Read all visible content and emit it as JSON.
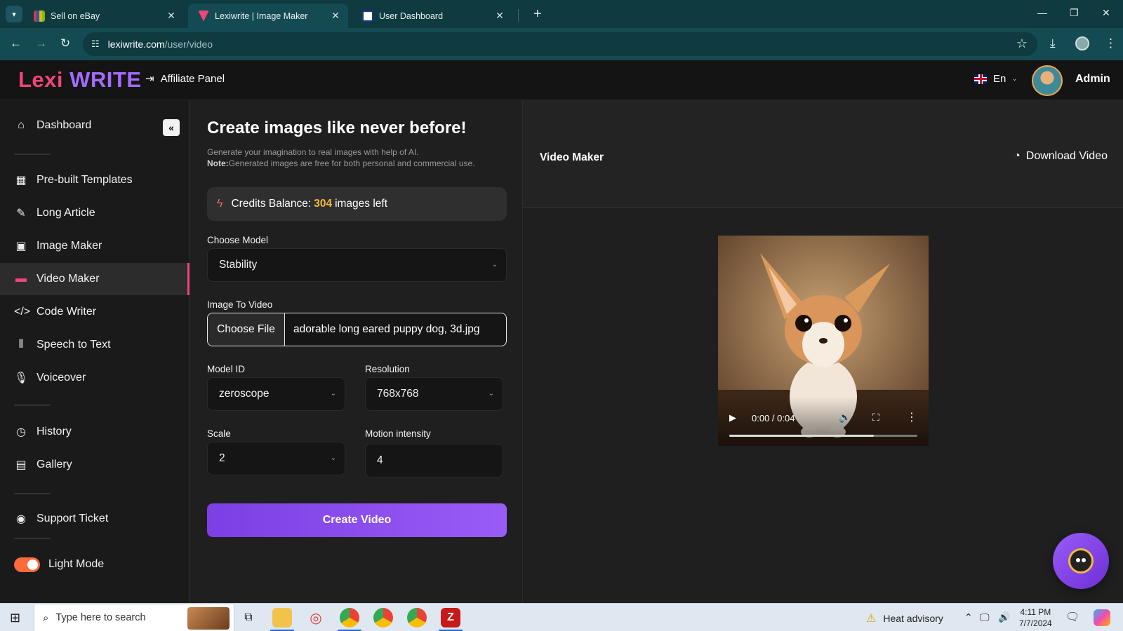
{
  "browser": {
    "tabs": [
      {
        "title": "Sell on eBay",
        "favicon": "ebay-icon",
        "active": false
      },
      {
        "title": "Lexiwrite | Image Maker",
        "favicon": "lexiwrite-icon",
        "active": true
      },
      {
        "title": "User Dashboard",
        "favicon": "dashboard-icon",
        "active": false
      }
    ],
    "url_host": "lexiwrite.com",
    "url_path": "/user/video"
  },
  "header": {
    "logo_part1": "Lexi",
    "logo_part2": "WRITE",
    "affiliate_label": "Affiliate Panel",
    "language": "En",
    "user_name": "Admin"
  },
  "sidebar": {
    "items": [
      {
        "label": "Dashboard",
        "icon": "home-icon"
      },
      {
        "label": "Pre-built Templates",
        "icon": "grid-icon"
      },
      {
        "label": "Long Article",
        "icon": "pen-icon"
      },
      {
        "label": "Image Maker",
        "icon": "image-icon"
      },
      {
        "label": "Video Maker",
        "icon": "video-icon",
        "active": true
      },
      {
        "label": "Code Writer",
        "icon": "code-icon"
      },
      {
        "label": "Speech to Text",
        "icon": "waveform-icon"
      },
      {
        "label": "Voiceover",
        "icon": "microphone-icon"
      },
      {
        "label": "History",
        "icon": "history-icon"
      },
      {
        "label": "Gallery",
        "icon": "gallery-icon"
      },
      {
        "label": "Support Ticket",
        "icon": "support-icon"
      }
    ],
    "light_mode_label": "Light Mode",
    "light_mode_on": true
  },
  "form": {
    "heading": "Create images like never before!",
    "subtitle": "Generate your imagination to real images with help of AI.",
    "note_label": "Note:",
    "note_text": "Generated images are free for both personal and commercial use.",
    "credits_prefix": "Credits Balance:",
    "credits_value": "304",
    "credits_suffix": "images left",
    "choose_model_label": "Choose Model",
    "choose_model_value": "Stability",
    "image_to_video_label": "Image To Video",
    "choose_file_button": "Choose File",
    "file_name": "adorable long eared puppy dog, 3d.jpg",
    "model_id_label": "Model ID",
    "model_id_value": "zeroscope",
    "resolution_label": "Resolution",
    "resolution_value": "768x768",
    "scale_label": "Scale",
    "scale_value": "2",
    "motion_label": "Motion intensity",
    "motion_value": "4",
    "create_button": "Create Video"
  },
  "video_panel": {
    "title": "Video Maker",
    "download_label": "Download Video",
    "time_display": "0:00 / 0:04",
    "progress_fraction": 0.77
  },
  "taskbar": {
    "search_placeholder": "Type here to search",
    "weather_text": "Heat advisory",
    "time": "4:11 PM",
    "date": "7/7/2024"
  },
  "colors": {
    "accent_purple": "#8b4ef0",
    "accent_pink": "#f0447a",
    "credits_yellow": "#f5b73b",
    "toggle_orange": "#ff6a3d"
  }
}
